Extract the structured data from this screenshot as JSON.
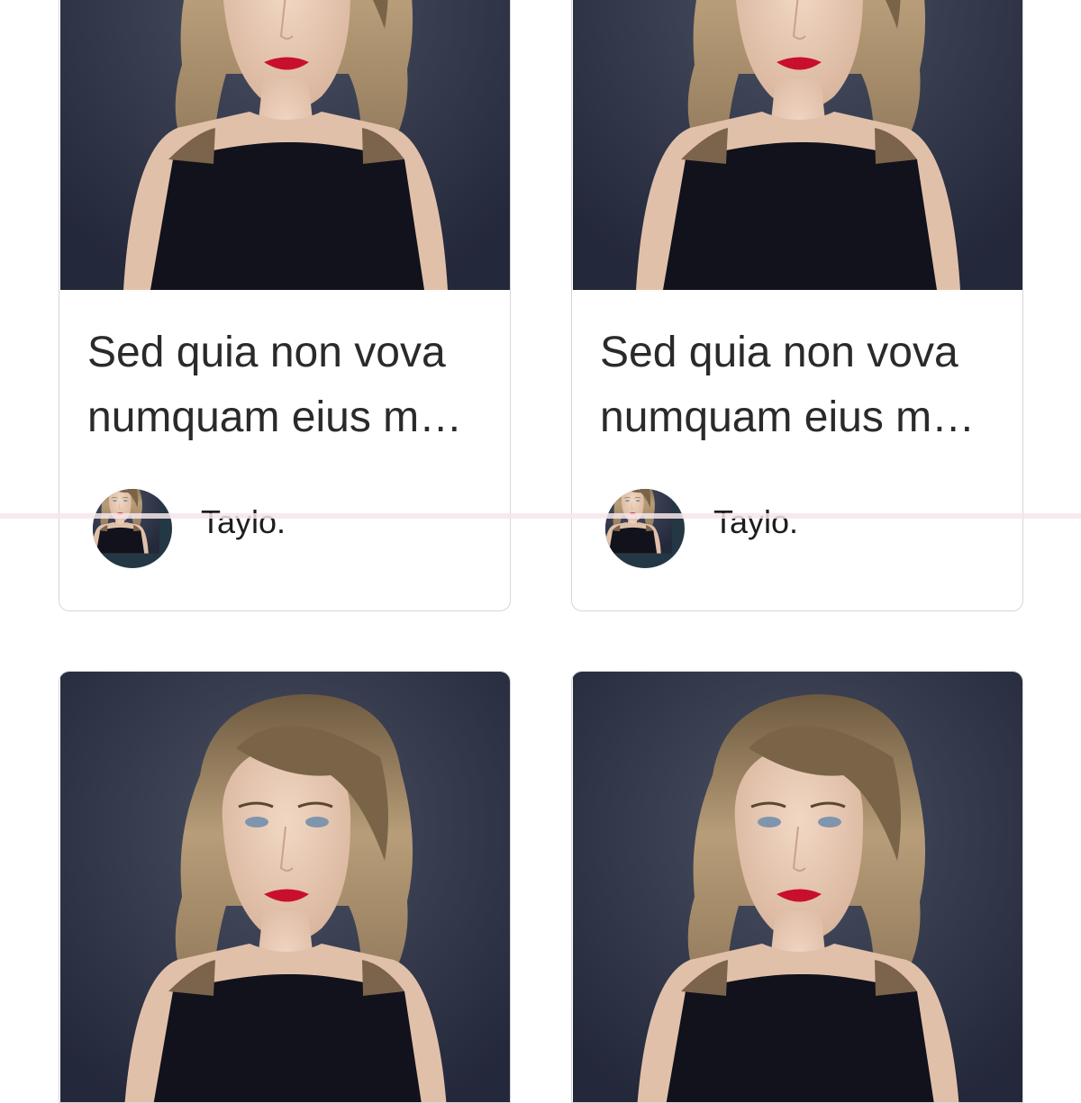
{
  "cards": [
    {
      "title": "Sed quia non vova numquam eius m…",
      "author": "Taylo."
    },
    {
      "title": "Sed quia non vova numquam eius m…",
      "author": "Taylo."
    },
    {
      "title": "",
      "author": ""
    },
    {
      "title": "",
      "author": ""
    }
  ],
  "icons": {
    "avatar": "author-avatar",
    "photo": "portrait-photo"
  },
  "colors": {
    "background": "#ffffff",
    "card_border": "#d6d6d9",
    "photo_background": "#2b3140",
    "lipstick": "#c8102e"
  }
}
